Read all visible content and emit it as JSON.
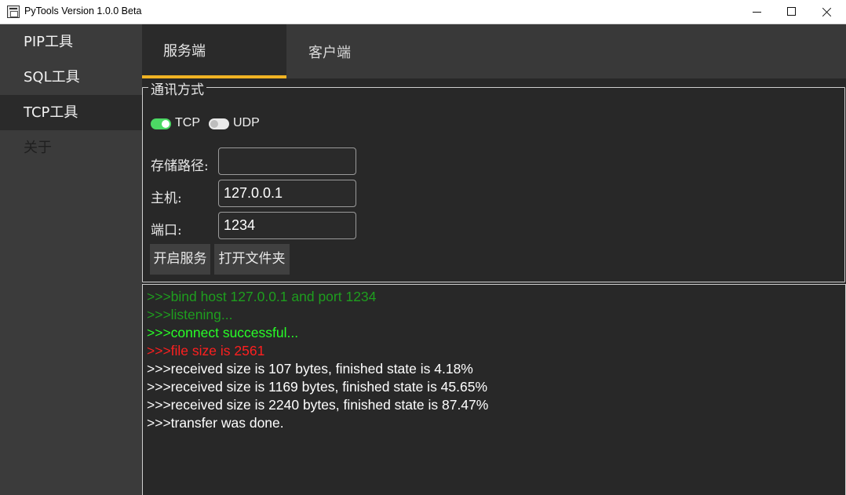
{
  "window": {
    "title": "PyTools Version 1.0.0 Beta"
  },
  "sidebar": {
    "items": [
      {
        "label": "PIP工具"
      },
      {
        "label": "SQL工具"
      },
      {
        "label": "TCP工具"
      },
      {
        "label": "关于"
      }
    ],
    "active_index": 2
  },
  "tabs": [
    {
      "label": "服务端",
      "active": true
    },
    {
      "label": "客户端",
      "active": false
    }
  ],
  "colors": {
    "accent": "#f0b323",
    "toggle_on": "#4cd964",
    "log_info": "#1e9e1e",
    "log_success": "#27ff27",
    "log_error": "#ff1f1f",
    "log_default": "#ffffff"
  },
  "form": {
    "group_title": "通讯方式",
    "protocols": [
      {
        "label": "TCP",
        "checked": true
      },
      {
        "label": "UDP",
        "checked": false
      }
    ],
    "save_path_label": "存储路径:",
    "save_path_value": "",
    "host_label": "主机:",
    "host_value": "127.0.0.1",
    "port_label": "端口:",
    "port_value": "1234",
    "start_button": "开启服务",
    "open_folder_button": "打开文件夹"
  },
  "console": {
    "lines": [
      {
        "text": ">>>bind host 127.0.0.1 and port 1234",
        "color": "#1e9e1e"
      },
      {
        "text": ">>>listening...",
        "color": "#1e9e1e"
      },
      {
        "text": ">>>connect successful...",
        "color": "#27ff27"
      },
      {
        "text": ">>>file size is 2561",
        "color": "#ff1f1f"
      },
      {
        "text": ">>>received size is 107 bytes, finished state is 4.18%",
        "color": "#ffffff"
      },
      {
        "text": ">>>received size is 1169 bytes, finished state is 45.65%",
        "color": "#ffffff"
      },
      {
        "text": ">>>received size is 2240 bytes, finished state is 87.47%",
        "color": "#ffffff"
      },
      {
        "text": ">>>transfer was done.",
        "color": "#ffffff"
      }
    ]
  }
}
